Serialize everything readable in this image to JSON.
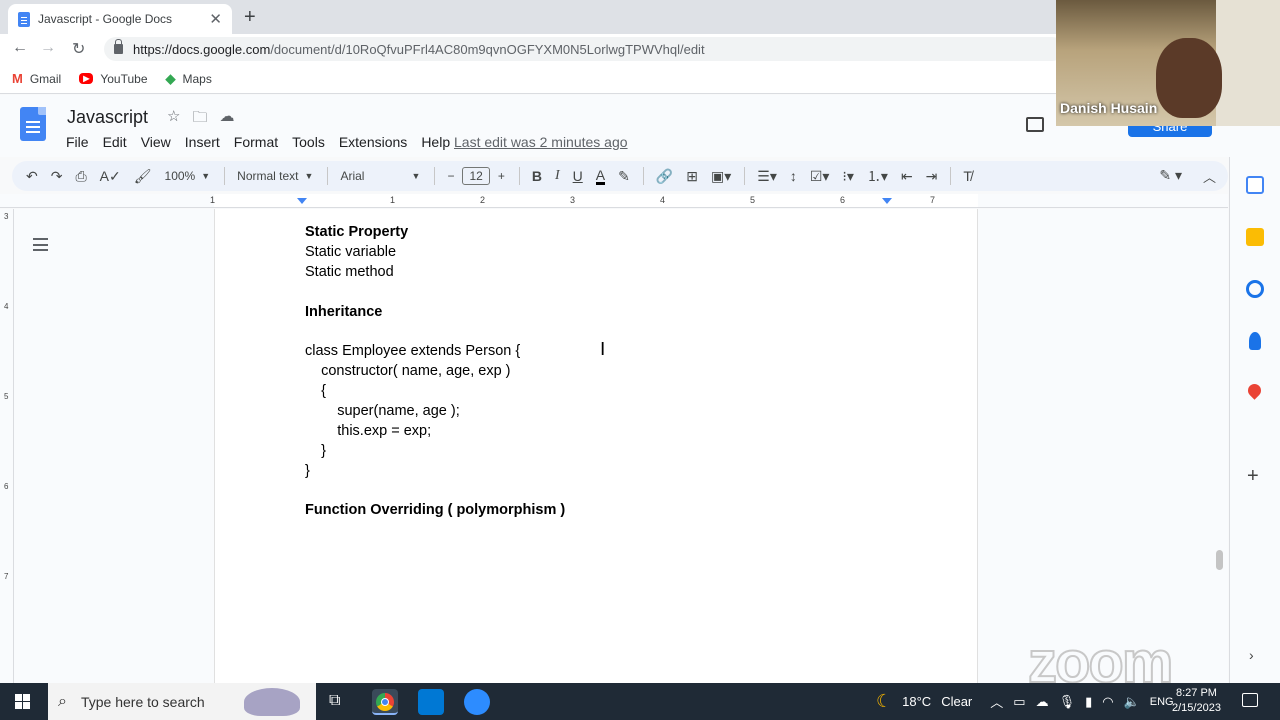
{
  "browser": {
    "tab_title": "Javascript - Google Docs",
    "url_host": "https://docs.google.com",
    "url_path": "/document/d/10RoQfvuPFrl4AC80m9qvnOGFYXM0N5LorlwgTPWVhql/edit",
    "bookmarks": [
      "Gmail",
      "YouTube",
      "Maps"
    ]
  },
  "docs": {
    "title": "Javascript",
    "menu": [
      "File",
      "Edit",
      "View",
      "Insert",
      "Format",
      "Tools",
      "Extensions",
      "Help"
    ],
    "last_edit": "Last edit was 2 minutes ago",
    "share_label": "Share"
  },
  "toolbar": {
    "zoom": "100%",
    "style": "Normal text",
    "font": "Arial",
    "font_size": "12"
  },
  "ruler": {
    "numbers": [
      "1",
      "1",
      "2",
      "3",
      "4",
      "5",
      "6",
      "7"
    ],
    "vertical_numbers": [
      "3",
      "4",
      "5",
      "6",
      "7"
    ]
  },
  "document": {
    "lines": [
      {
        "text": "Static Property",
        "bold": true
      },
      {
        "text": "Static variable",
        "bold": false
      },
      {
        "text": "Static method",
        "bold": false
      },
      {
        "text": "",
        "bold": false
      },
      {
        "text": "Inheritance",
        "bold": true
      },
      {
        "text": "",
        "bold": false
      },
      {
        "text": "class Employee extends Person {",
        "bold": false
      },
      {
        "text": "    constructor( name, age, exp )",
        "bold": false
      },
      {
        "text": "    {",
        "bold": false
      },
      {
        "text": "        super(name, age );",
        "bold": false
      },
      {
        "text": "        this.exp = exp;",
        "bold": false
      },
      {
        "text": "    }",
        "bold": false
      },
      {
        "text": "}",
        "bold": false
      },
      {
        "text": "",
        "bold": false
      },
      {
        "text": "Function Overriding ( polymorphism )",
        "bold": true
      }
    ]
  },
  "overlay": {
    "participant_name": "Danish Husain",
    "watermark": "zoom"
  },
  "taskbar": {
    "search_placeholder": "Type here to search",
    "weather_temp": "18°C",
    "weather_desc": "Clear",
    "language": "ENG",
    "time": "8:27 PM",
    "date": "2/15/2023"
  },
  "colors": {
    "docs_blue": "#4285f4",
    "share_blue": "#1a73e8",
    "taskbar": "#1f2a36"
  }
}
